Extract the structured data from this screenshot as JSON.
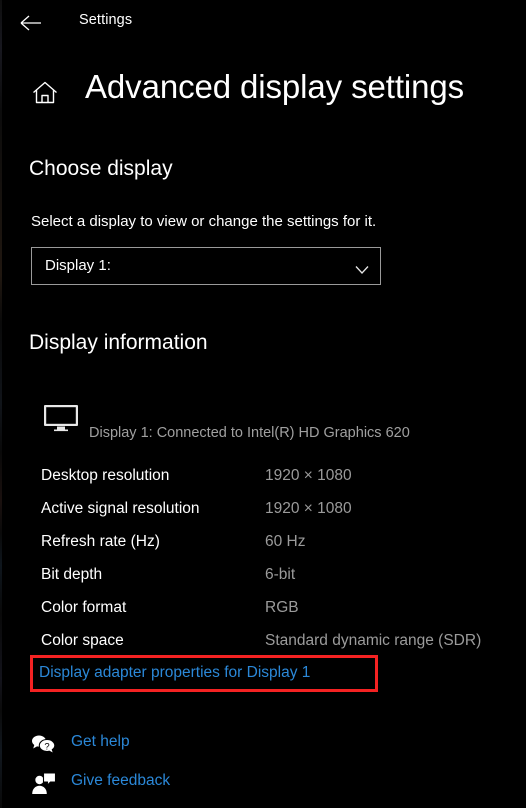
{
  "window": {
    "titlebar_label": "Settings",
    "back_icon": "back-arrow-icon",
    "home_icon": "home-icon",
    "page_title": "Advanced display settings"
  },
  "choose_display": {
    "heading": "Choose display",
    "subtitle": "Select a display to view or change the settings for it.",
    "dropdown": {
      "selected": "Display 1:",
      "chevron_icon": "chevron-down-icon"
    }
  },
  "display_information": {
    "heading": "Display information",
    "monitor_icon": "monitor-icon",
    "connection": "Display 1: Connected to Intel(R) HD Graphics 620",
    "rows": [
      {
        "label": "Desktop resolution",
        "value": "1920 × 1080"
      },
      {
        "label": "Active signal resolution",
        "value": "1920 × 1080"
      },
      {
        "label": "Refresh rate (Hz)",
        "value": "60 Hz"
      },
      {
        "label": "Bit depth",
        "value": "6-bit"
      },
      {
        "label": "Color format",
        "value": "RGB"
      },
      {
        "label": "Color space",
        "value": "Standard dynamic range (SDR)"
      }
    ],
    "adapter_link": "Display adapter properties for Display 1"
  },
  "footer": {
    "get_help": {
      "label": "Get help",
      "icon": "help-bubbles-icon"
    },
    "give_feedback": {
      "label": "Give feedback",
      "icon": "feedback-person-icon"
    }
  },
  "colors": {
    "background": "#000000",
    "text_primary": "#ffffff",
    "text_secondary": "#9b9b9b",
    "link_blue": "#2b88d8",
    "highlight_red": "#f42222",
    "control_border": "#9a9a9a"
  }
}
